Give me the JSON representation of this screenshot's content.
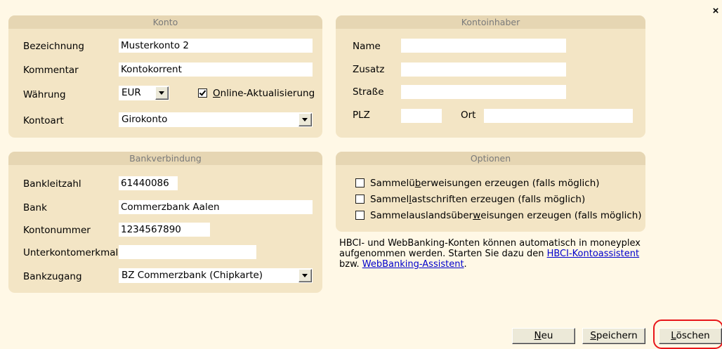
{
  "close_label": "×",
  "konto": {
    "header": "Konto",
    "bezeichnung_label": "Bezeichnung",
    "bezeichnung_value": "Musterkonto 2",
    "kommentar_label": "Kommentar",
    "kommentar_value": "Kontokorrent",
    "waehrung_label": "Währung",
    "waehrung_value": "EUR",
    "online_checked": true,
    "online_label_pre": "",
    "online_label_key": "O",
    "online_label_post": "nline-Aktualisierung",
    "kontoart_label": "Kontoart",
    "kontoart_value": "Girokonto"
  },
  "kontoinhaber": {
    "header": "Kontoinhaber",
    "name_label": "Name",
    "name_value": "",
    "zusatz_label": "Zusatz",
    "zusatz_value": "",
    "strasse_label": "Straße",
    "strasse_value": "",
    "plz_label": "PLZ",
    "plz_value": "",
    "ort_label": "Ort",
    "ort_value": ""
  },
  "bank": {
    "header": "Bankverbindung",
    "blz_label": "Bankleitzahl",
    "blz_value": "61440086",
    "bank_label": "Bank",
    "bank_value": "Commerzbank Aalen",
    "kontonummer_label": "Kontonummer",
    "kontonummer_value": "1234567890",
    "unterkonto_label": "Unterkontomerkmal",
    "unterkonto_value": "",
    "zugang_label": "Bankzugang",
    "zugang_value": "BZ Commerzbank (Chipkarte)"
  },
  "optionen": {
    "header": "Optionen",
    "opt1_pre": "Sammelü",
    "opt1_key": "b",
    "opt1_post": "erweisungen erzeugen (falls möglich)",
    "opt1_checked": false,
    "opt2_pre": "Sammel",
    "opt2_key": "l",
    "opt2_post": "astschriften erzeugen (falls möglich)",
    "opt2_checked": false,
    "opt3_pre": "Sammelauslandsüber",
    "opt3_key": "w",
    "opt3_post": "eisungen erzeugen (falls möglich)",
    "opt3_checked": false
  },
  "info": {
    "text1": "HBCI- und WebBanking-Konten können automatisch in moneyplex aufgenommen werden. Starten Sie dazu den ",
    "link1": "HBCI-Kontoassistent",
    "text2": " bzw. ",
    "link2": "WebBanking-Assistent",
    "text3": "."
  },
  "buttons": {
    "neu_key": "N",
    "neu_rest": "eu",
    "speichern_key": "S",
    "speichern_rest": "peichern",
    "loeschen_key": "L",
    "loeschen_rest": "öschen"
  },
  "colors": {
    "background": "#fff8e6",
    "panel": "#f3e5c5",
    "panel_header": "#e6d6b3",
    "link": "#0000cc",
    "highlight_ring": "#e8161a"
  }
}
